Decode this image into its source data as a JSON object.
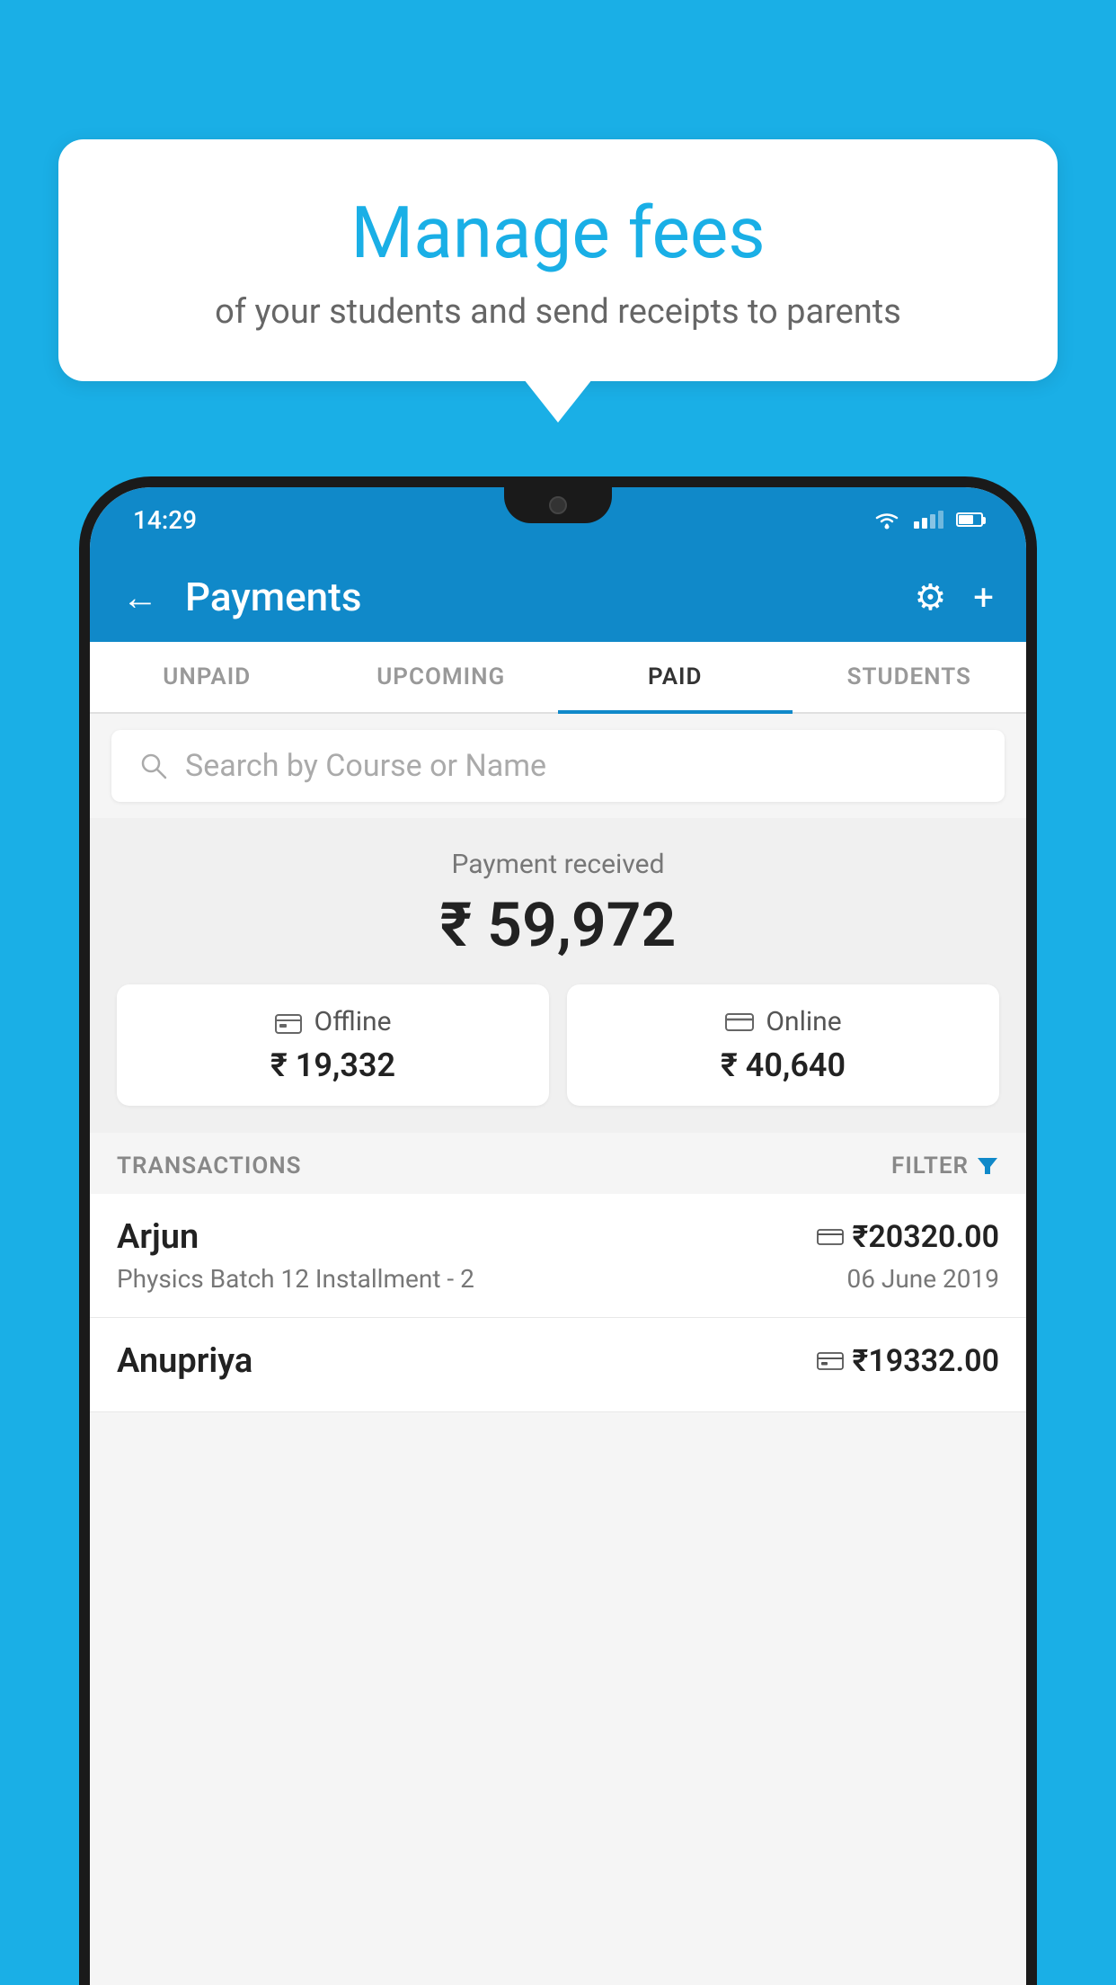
{
  "background_color": "#1AAFE6",
  "speech_bubble": {
    "title": "Manage fees",
    "subtitle": "of your students and send receipts to parents"
  },
  "status_bar": {
    "time": "14:29",
    "wifi": true,
    "signal": true,
    "battery": true
  },
  "app_header": {
    "title": "Payments",
    "back_icon": "←",
    "settings_icon": "⚙",
    "add_icon": "+"
  },
  "tabs": [
    {
      "label": "UNPAID",
      "active": false
    },
    {
      "label": "UPCOMING",
      "active": false
    },
    {
      "label": "PAID",
      "active": true
    },
    {
      "label": "STUDENTS",
      "active": false
    }
  ],
  "search": {
    "placeholder": "Search by Course or Name"
  },
  "payment_summary": {
    "label": "Payment received",
    "amount": "₹ 59,972",
    "offline": {
      "type": "Offline",
      "amount": "₹ 19,332"
    },
    "online": {
      "type": "Online",
      "amount": "₹ 40,640"
    }
  },
  "transactions_section": {
    "label": "TRANSACTIONS",
    "filter_label": "FILTER"
  },
  "transactions": [
    {
      "name": "Arjun",
      "course": "Physics Batch 12 Installment - 2",
      "amount": "₹20320.00",
      "date": "06 June 2019",
      "payment_type": "online"
    },
    {
      "name": "Anupriya",
      "course": "",
      "amount": "₹19332.00",
      "date": "",
      "payment_type": "offline"
    }
  ]
}
